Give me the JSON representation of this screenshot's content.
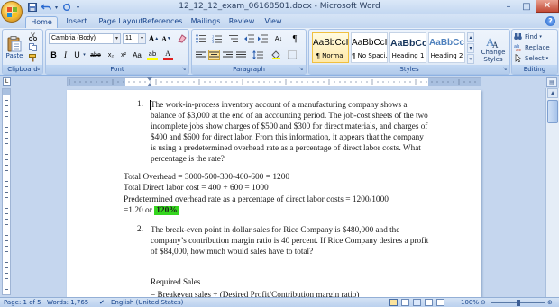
{
  "window": {
    "title": "12_12_12_exam_06168501.docx - Microsoft Word",
    "min_glyph": "–",
    "max_glyph": "□",
    "close_glyph": "✕"
  },
  "tabs": [
    {
      "label": "Home"
    },
    {
      "label": "Insert"
    },
    {
      "label": "Page Layout"
    },
    {
      "label": "References"
    },
    {
      "label": "Mailings"
    },
    {
      "label": "Review"
    },
    {
      "label": "View"
    }
  ],
  "help_glyph": "?",
  "ribbon": {
    "clipboard": {
      "label": "Clipboard",
      "paste": "Paste"
    },
    "font": {
      "label": "Font",
      "family": "Cambria (Body)",
      "size": "11",
      "grow": "A",
      "shrink": "A",
      "bold": "B",
      "italic": "I",
      "underline": "U",
      "strike": "abe",
      "sub": "x₂",
      "sup": "x²",
      "case": "Aa",
      "color_a": "A",
      "highlight_a": "ab"
    },
    "paragraph": {
      "label": "Paragraph",
      "sort": "A↓",
      "pilcrow": "¶"
    },
    "styles": {
      "label": "Styles",
      "items": [
        {
          "sample": "AaBbCcI",
          "name": "¶ Normal"
        },
        {
          "sample": "AaBbCcI",
          "name": "¶ No Spaci..."
        },
        {
          "sample": "AaBbCc",
          "name": "Heading 1"
        },
        {
          "sample": "AaBbCc",
          "name": "Heading 2"
        }
      ],
      "change_styles": "Change Styles",
      "colors": {
        "heading": "#17365d",
        "accent": "#4f81bd"
      }
    },
    "editing": {
      "label": "Editing",
      "find": "Find",
      "replace": "Replace",
      "select": "Select"
    }
  },
  "document": {
    "q1_number": "1.",
    "q1_lines": [
      "The work-in-process inventory account of a manufacturing company shows a",
      "balance of $3,000 at the end of an accounting period. The job-cost sheets of the two",
      "incomplete jobs show charges of $500 and $300 for direct materials, and charges of",
      "$400 and $600 for direct labor.  From this information, it appears  that the company",
      "is using a predetermined overhead rate as a percentage of  direct labor costs. What",
      "percentage is the rate?"
    ],
    "answer_lines": [
      "Total Overhead = 3000-500-300-400-600 = 1200",
      "Total Direct labor cost = 400 + 600 = 1000",
      "Predetermined overhead rate as a percentage of  direct labor costs = 1200/1000"
    ],
    "answer_last_prefix": "=1.20 or",
    "answer_highlight": "120%",
    "highlight_color": "#35d51f",
    "q2_number": "2.",
    "q2_lines": [
      "The break-even point in dollar sales for Rice Company is  $480,000 and the",
      "company’s contribution margin ratio is 40 percent. If Rice Company desires a profit",
      "of  $84,000, how much would sales have to total?"
    ],
    "required_heading": "Required Sales",
    "formula_line": "= Breakeven sales + (Desired Profit/Contribution margin ratio)"
  },
  "statusbar": {
    "page": "Page: 1 of 5",
    "words": "Words: 1,765",
    "language": "English (United States)",
    "zoom": "100%",
    "zoom_minus": "⊖",
    "zoom_plus": "⊕"
  }
}
